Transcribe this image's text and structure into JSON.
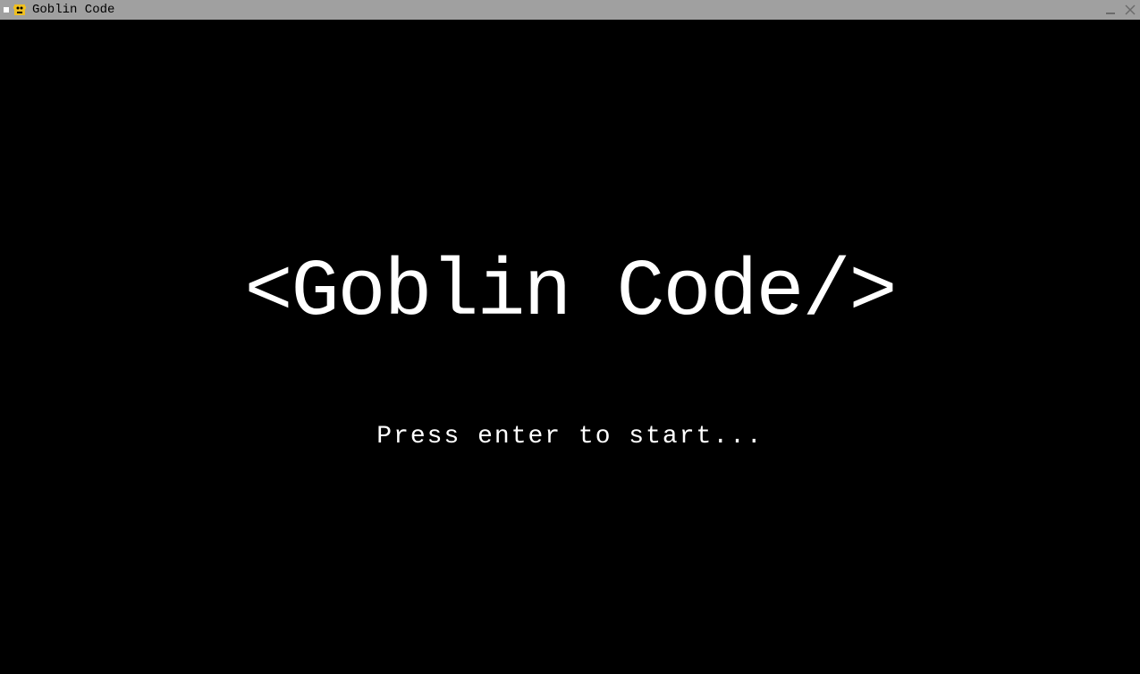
{
  "window": {
    "title": "Goblin Code"
  },
  "game": {
    "title": "<Goblin Code/>",
    "prompt": "Press enter to start..."
  }
}
